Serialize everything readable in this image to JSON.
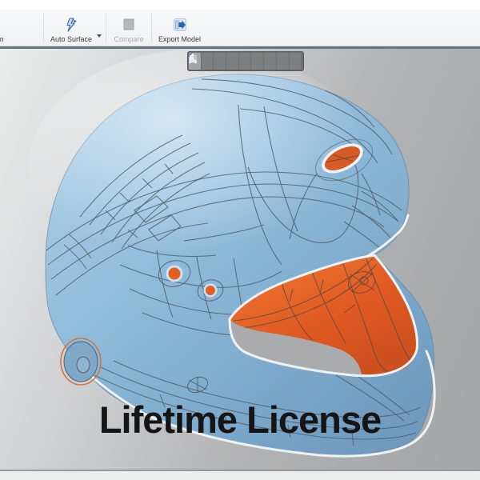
{
  "ribbon": {
    "partial_label": "m",
    "buttons": [
      {
        "label": "Auto Surface",
        "icon": "lightning-bolt-icon",
        "enabled": true,
        "has_dropdown": true
      },
      {
        "label": "Compare",
        "icon": "compare-sheet-icon",
        "enabled": false,
        "has_dropdown": false
      },
      {
        "label": "Export Model",
        "icon": "export-arrow-icon",
        "enabled": true,
        "has_dropdown": false
      }
    ]
  },
  "view_toolbar": {
    "active": "zoom-view",
    "buttons": [
      "zoom-view-icon",
      "front-view-icon",
      "back-view-icon",
      "right-view-icon",
      "left-view-icon",
      "top-view-icon",
      "bottom-view-icon",
      "isometric-view-icon",
      "axis-triad-icon"
    ]
  },
  "viewport": {
    "watermark": "Lifetime License",
    "model": "helmet-3d-scan"
  },
  "colors": {
    "helmet_blue": "#8FBBDB",
    "interior_orange": "#E0602A",
    "wireframe_line": "#4E5C68",
    "edge_highlight_white": "#EFF2F3",
    "background_light": "#EAECEC",
    "background_dark": "#A3A5A7",
    "toolbar_gray": "#6E7072",
    "accent_blue": "#2B64B0",
    "watermark_text": "#151515"
  }
}
